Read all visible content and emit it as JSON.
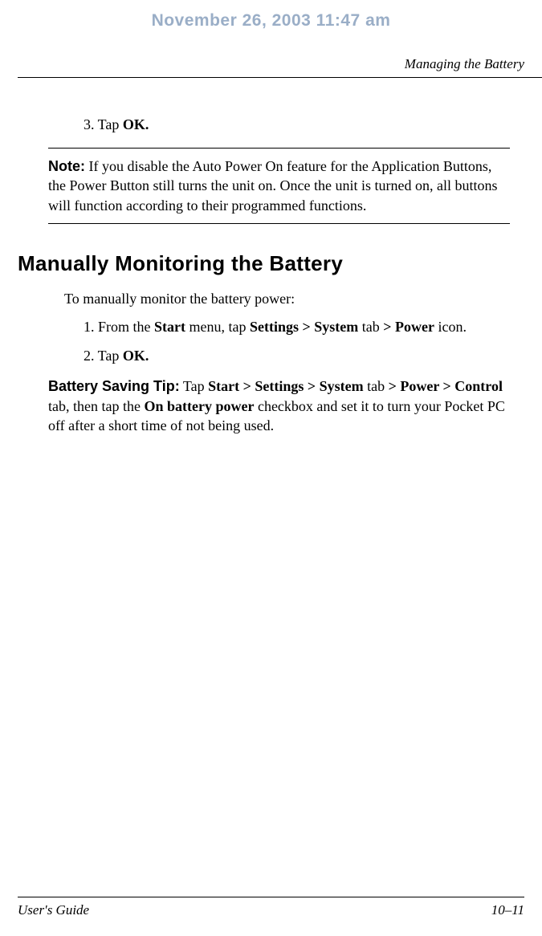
{
  "draft_timestamp": "November 26, 2003 11:47 am",
  "running_head": "Managing the Battery",
  "step3": {
    "num": "3.",
    "pre": " Tap ",
    "bold": "OK."
  },
  "note": {
    "label": "Note:",
    "text": " If you disable the Auto Power On feature for the Application Buttons, the Power Button still turns the unit on. Once the unit is turned on, all buttons will function according to their programmed functions."
  },
  "heading": "Manually Monitoring the Battery",
  "intro": "To manually monitor the battery power:",
  "steps": {
    "s1": {
      "num": "1.",
      "t1": " From the ",
      "b1": "Start",
      "t2": " menu, tap ",
      "b2": "Settings > System",
      "t3": " tab ",
      "b3": "> Power",
      "t4": " icon."
    },
    "s2": {
      "num": "2.",
      "t1": " Tap ",
      "b1": "OK."
    }
  },
  "tip": {
    "label": "Battery Saving Tip:",
    "t1": " Tap ",
    "b1": "Start > Settings > System",
    "t2": " tab ",
    "b2": "> Power > Control",
    "t3": " tab, then tap the ",
    "b3": "On battery power",
    "t4": " checkbox and set it to turn your Pocket PC off after a short time of not being used."
  },
  "footer": {
    "left": "User's Guide",
    "right": "10–11"
  }
}
